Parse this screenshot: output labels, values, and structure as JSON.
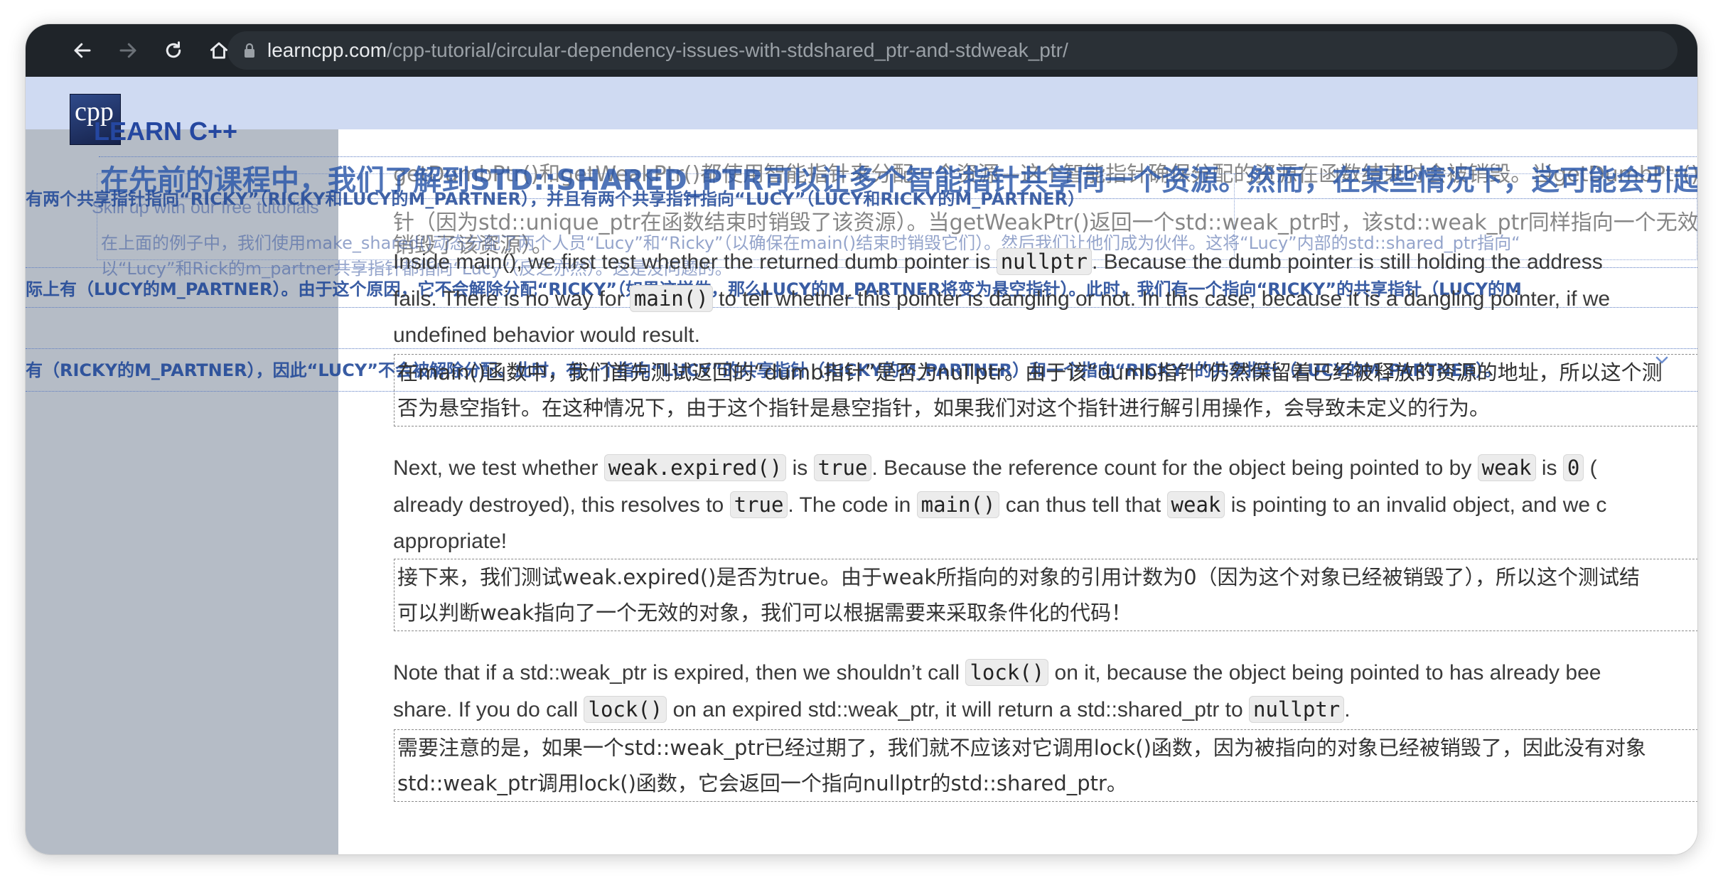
{
  "browser": {
    "url_host": "learncpp.com",
    "url_path": "/cpp-tutorial/circular-dependency-issues-with-stdshared_ptr-and-stdweak_ptr/"
  },
  "site": {
    "logo_text": "cpp",
    "title": "LEARN C++",
    "tagline": "Skill up with our free tutorials"
  },
  "overlay": {
    "big": "在先前的课程中，我们了解到STD::SHARED_PTR可以让多个智能指针共享同一个资源。然而，在某些情况下，这可能会引起问题。考虑以",
    "line1": "有两个共享指针指向“RICKY”（RICKY和LUCY的M_PARTNER），并且有两个共享指针指向“LUCY”（LUCY和RICKY的M_PARTNER）",
    "line2": "在上面的例子中，我们使用make_shared()动态分配了两个人员“Lucy”和“Ricky”（以确保在main()结束时销毁它们）。然后我们让他们成为伙伴。这将“Lucy”内部的std::shared_ptr指向“",
    "line3": "以“Lucy”和Rick的m_partner共享指针都指向“Lucy”（反之亦然）。这是没问题的。",
    "line4": "际上有（LUCY的M_PARTNER）。由于这个原因，它不会解除分配“RICKY”（如果这样做，那么LUCY的M_PARTNER将变为悬空指针）。此时，我们有一个指向“RICKY”的共享指针（LUCY的M",
    "line5": "有（RICKY的M_PARTNER），因此“LUCY”不会被解除分配。此时，有一个指向“LUCY”的共享指针（RICKY的M_PARTNER）和一个指向“RICKY”的共享指针（LUCY的M_PARTNER）。"
  },
  "article": {
    "bg_zh1": "getDumbPtr()和getWeakPtr()都使用智能指针来分配一个资源—这个智能指针确保分配的资源在函数结束时会被销毁。当getDumbPtr()返",
    "bg_zh2": "针（因为std::unique_ptr在函数结束时销毁了该资源）。当getWeakPtr()返回一个std::weak_ptr时，该std::weak_ptr同样指向一个无效",
    "bg_zh3": "销毁了该资源）。",
    "p1": {
      "l1a": "Inside main(), we first test whether the returned dumb pointer is ",
      "l1code": "nullptr",
      "l1b": ". Because the dumb pointer is still holding the address",
      "l2a": "fails. There is no way for ",
      "l2code": "main()",
      "l2b": " to tell whether this pointer is dangling or not. In this case, because it is a dangling pointer, if we",
      "l3": "undefined behavior would result."
    },
    "z1": {
      "l1": "在main()函数中，我们首先测试返回的“dumb指针”是否为nullptr。由于该“dumb指针”仍然保留着已经被释放的资源的地址，所以这个测",
      "l2": "否为悬空指针。在这种情况下，由于这个指针是悬空指针，如果我们对这个指针进行解引用操作，会导致未定义的行为。"
    },
    "p2": {
      "a": "Next, we test whether ",
      "c1": "weak.expired()",
      "b": " is ",
      "c2": "true",
      "d": ". Because the reference count for the object being pointed to by ",
      "c3": "weak",
      "e": " is ",
      "c4": "0",
      "f": " (",
      "l2a": "already destroyed), this resolves to ",
      "l2c1": "true",
      "l2b": ". The code in ",
      "l2c2": "main()",
      "l2d": " can thus tell that ",
      "l2c3": "weak",
      "l2e": " is pointing to an invalid object, and we c",
      "l3": "appropriate!"
    },
    "z2": {
      "l1": "接下来，我们测试weak.expired()是否为true。由于weak所指向的对象的引用计数为0（因为这个对象已经被销毁了），所以这个测试结",
      "l2": "可以判断weak指向了一个无效的对象，我们可以根据需要来采取条件化的代码！"
    },
    "p3": {
      "a": "Note that if a std::weak_ptr is expired, then we shouldn’t call ",
      "c1": "lock()",
      "b": " on it, because the object being pointed to has already bee",
      "l2a": "share. If you do call ",
      "l2c1": "lock()",
      "l2b": " on an expired std::weak_ptr, it will return a std::shared_ptr to ",
      "l2c2": "nullptr",
      "l2d": "."
    },
    "z3": {
      "l1": "需要注意的是，如果一个std::weak_ptr已经过期了，我们就不应该对它调用lock()函数，因为被指向的对象已经被销毁了，因此没有对象",
      "l2": "std::weak_ptr调用lock()函数，它会返回一个指向nullptr的std::shared_ptr。"
    }
  }
}
